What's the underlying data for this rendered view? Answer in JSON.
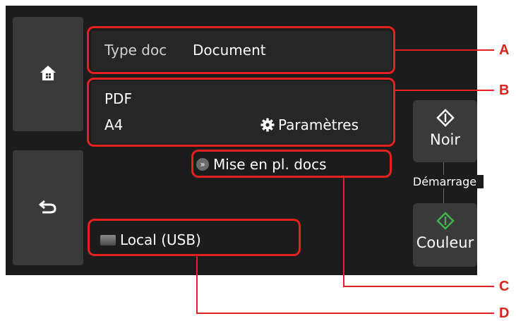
{
  "colors": {
    "callout_red": "#e8201f",
    "start_green": "#3fb34f"
  },
  "nav": {
    "home_icon": "home-icon",
    "back_icon": "back-arrow-icon"
  },
  "doc_type": {
    "label": "Type doc",
    "value": "Document"
  },
  "format_panel": {
    "format": "PDF",
    "size": "A4",
    "settings_icon": "gear-icon",
    "settings_label": "Paramètres"
  },
  "layout_button": {
    "icon": "double-chevron-right-icon",
    "label": "Mise en pl. docs"
  },
  "destination": {
    "icon": "drive-icon",
    "label": "Local (USB)"
  },
  "start": {
    "black_label": "Noir",
    "group_label": "Démarrage",
    "color_label": "Couleur"
  },
  "callouts": {
    "a": "A",
    "b": "B",
    "c": "C",
    "d": "D"
  }
}
